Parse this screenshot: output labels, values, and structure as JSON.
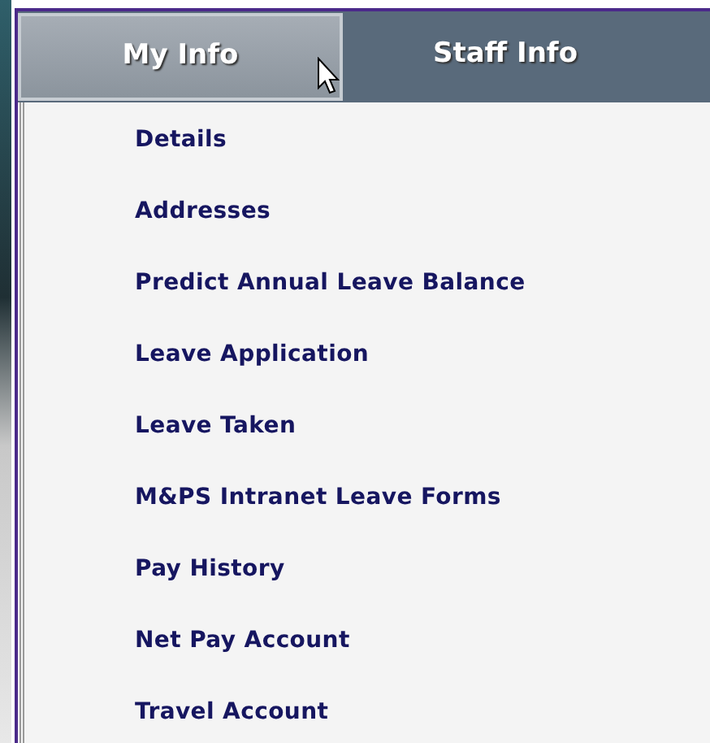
{
  "tabs": [
    {
      "label": "My Info",
      "selected": true
    },
    {
      "label": "Staff Info",
      "selected": false
    }
  ],
  "menu": {
    "items": [
      {
        "label": "Details"
      },
      {
        "label": "Addresses"
      },
      {
        "label": "Predict Annual Leave Balance"
      },
      {
        "label": "Leave Application"
      },
      {
        "label": "Leave Taken"
      },
      {
        "label": "M&PS Intranet Leave Forms"
      },
      {
        "label": "Pay History"
      },
      {
        "label": "Net Pay Account"
      },
      {
        "label": "Travel Account"
      }
    ]
  }
}
